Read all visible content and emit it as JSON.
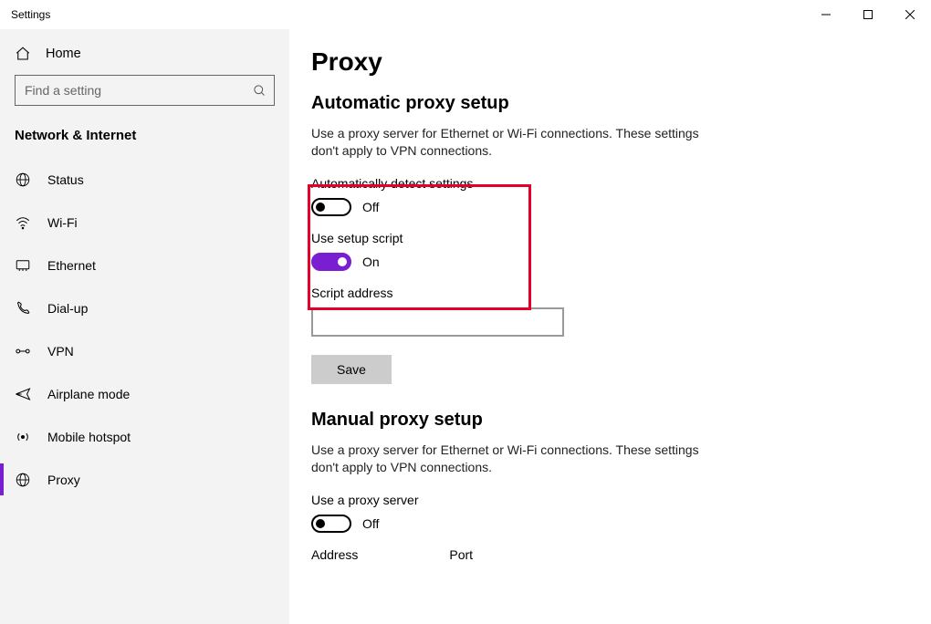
{
  "window": {
    "title": "Settings"
  },
  "sidebar": {
    "home_label": "Home",
    "search_placeholder": "Find a setting",
    "section": "Network & Internet",
    "items": [
      {
        "label": "Status",
        "icon": "status"
      },
      {
        "label": "Wi-Fi",
        "icon": "wifi"
      },
      {
        "label": "Ethernet",
        "icon": "ethernet"
      },
      {
        "label": "Dial-up",
        "icon": "dialup"
      },
      {
        "label": "VPN",
        "icon": "vpn"
      },
      {
        "label": "Airplane mode",
        "icon": "airplane"
      },
      {
        "label": "Mobile hotspot",
        "icon": "hotspot"
      },
      {
        "label": "Proxy",
        "icon": "proxy",
        "selected": true
      }
    ]
  },
  "page": {
    "title": "Proxy",
    "auto": {
      "heading": "Automatic proxy setup",
      "desc": "Use a proxy server for Ethernet or Wi-Fi connections. These settings don't apply to VPN connections.",
      "detect_label": "Automatically detect settings",
      "detect_state": "Off",
      "script_label": "Use setup script",
      "script_state": "On",
      "script_addr_label": "Script address",
      "script_addr_value": "",
      "save_label": "Save"
    },
    "manual": {
      "heading": "Manual proxy setup",
      "desc": "Use a proxy server for Ethernet or Wi-Fi connections. These settings don't apply to VPN connections.",
      "use_label": "Use a proxy server",
      "use_state": "Off",
      "addr_label": "Address",
      "port_label": "Port"
    }
  }
}
